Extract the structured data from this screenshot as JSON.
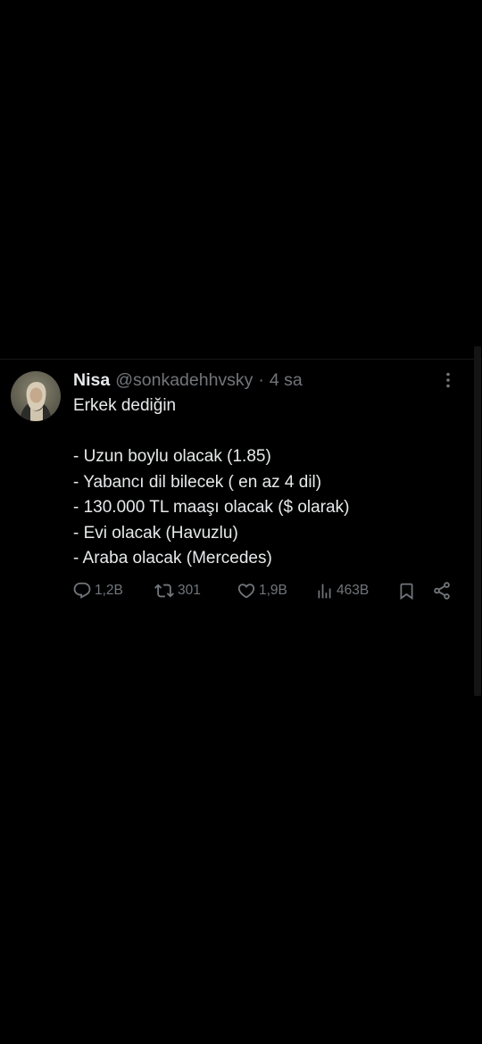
{
  "tweet": {
    "author": {
      "name": "Nisa",
      "handle": "@sonkadehhvsky",
      "separator": "·",
      "time": "4 sa"
    },
    "text": {
      "intro": "Erkek dediğin",
      "items": [
        "- Uzun boylu olacak (1.85)",
        "- Yabancı dil bilecek ( en az 4 dil)",
        "- 130.000 TL maaşı olacak ($ olarak)",
        "- Evi olacak (Havuzlu)",
        "- Araba olacak (Mercedes)"
      ]
    },
    "actions": {
      "replies": "1,2B",
      "retweets": "301",
      "likes": "1,9B",
      "views": "463B"
    }
  },
  "icons": {
    "more": "more-vertical-icon",
    "reply": "reply-icon",
    "retweet": "retweet-icon",
    "like": "heart-icon",
    "views": "views-chart-icon",
    "bookmark": "bookmark-icon",
    "share": "share-icon"
  },
  "colors": {
    "background": "#000000",
    "primary_text": "#e7e9ea",
    "secondary_text": "#71767b"
  }
}
